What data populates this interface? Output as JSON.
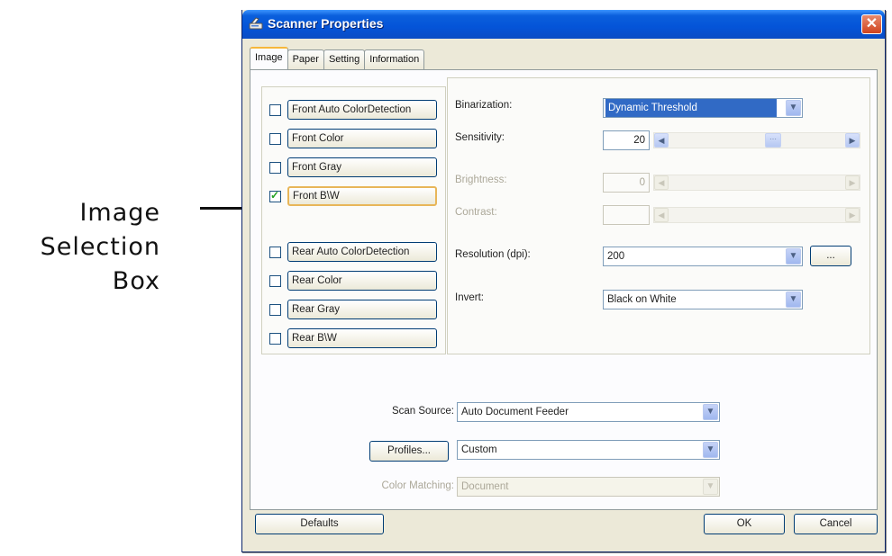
{
  "annotation": {
    "lines": [
      "Image",
      "Selection",
      "Box"
    ]
  },
  "window": {
    "title": "Scanner Properties",
    "close_glyph": "✕"
  },
  "tabs": [
    {
      "label": "Image",
      "active": true
    },
    {
      "label": "Paper",
      "active": false
    },
    {
      "label": "Setting",
      "active": false
    },
    {
      "label": "Information",
      "active": false
    }
  ],
  "image_types": [
    {
      "label": "Front Auto ColorDetection",
      "checked": false
    },
    {
      "label": "Front Color",
      "checked": false
    },
    {
      "label": "Front Gray",
      "checked": false
    },
    {
      "label": "Front B\\W",
      "checked": true
    },
    {
      "label": "Rear Auto ColorDetection",
      "checked": false
    },
    {
      "label": "Rear Color",
      "checked": false
    },
    {
      "label": "Rear Gray",
      "checked": false
    },
    {
      "label": "Rear B\\W",
      "checked": false
    }
  ],
  "settings": {
    "binarization": {
      "label": "Binarization:",
      "value": "Dynamic Threshold"
    },
    "sensitivity": {
      "label": "Sensitivity:",
      "value": "20"
    },
    "brightness": {
      "label": "Brightness:",
      "value": "0",
      "disabled": true
    },
    "contrast": {
      "label": "Contrast:",
      "value": "",
      "disabled": true
    },
    "resolution": {
      "label": "Resolution (dpi):",
      "value": "200",
      "more_button": "..."
    },
    "invert": {
      "label": "Invert:",
      "value": "Black on White"
    }
  },
  "scan_source": {
    "label": "Scan Source:",
    "value": "Auto Document Feeder"
  },
  "profiles": {
    "button": "Profiles...",
    "value": "Custom"
  },
  "color_matching": {
    "label": "Color Matching:",
    "value": "Document",
    "disabled": true
  },
  "footer": {
    "defaults": "Defaults",
    "ok": "OK",
    "cancel": "Cancel"
  },
  "icons": {
    "dropdown": "chevron-down-icon",
    "slider_left": "arrow-left-icon",
    "slider_right": "arrow-right-icon"
  },
  "colors": {
    "titlebar": "#0454d8",
    "selection": "#316ac5",
    "focus": "#e8b659"
  }
}
